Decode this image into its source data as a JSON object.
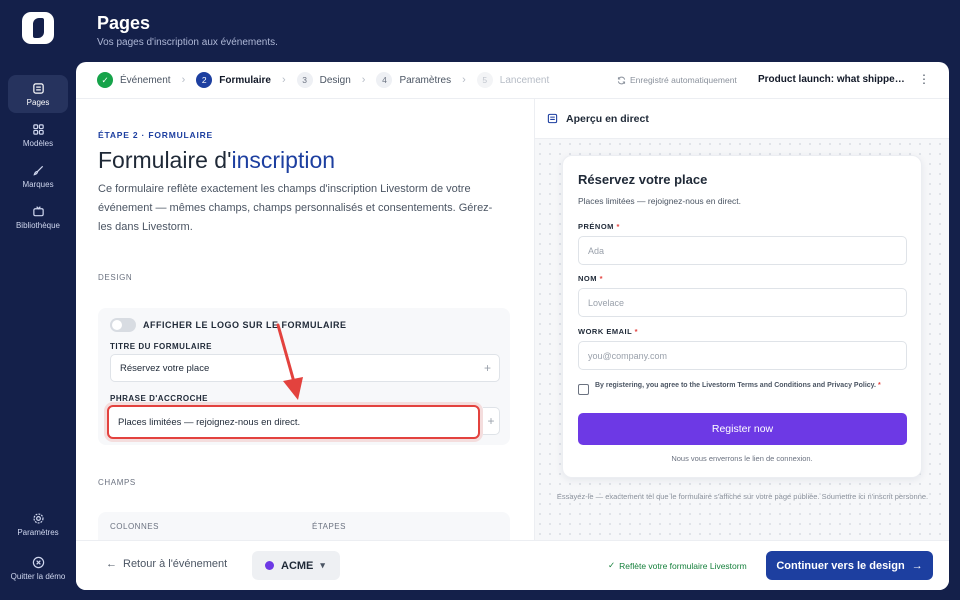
{
  "header": {
    "title": "Pages",
    "subtitle": "Vos pages d'inscription aux événements."
  },
  "sidebar": {
    "items": [
      {
        "label": "Pages",
        "icon": "pages-icon",
        "active": true
      },
      {
        "label": "Modèles",
        "icon": "grid-icon"
      },
      {
        "label": "Marques",
        "icon": "brush-icon"
      },
      {
        "label": "Bibliothèque",
        "icon": "tv-icon"
      }
    ],
    "settings_label": "Paramètres",
    "exit_label": "Quitter la démo"
  },
  "stepper": {
    "steps": [
      {
        "num": "✓",
        "label": "Événement",
        "state": "done"
      },
      {
        "num": "2",
        "label": "Formulaire",
        "state": "current"
      },
      {
        "num": "3",
        "label": "Design",
        "state": "todo"
      },
      {
        "num": "4",
        "label": "Paramètres",
        "state": "todo"
      },
      {
        "num": "5",
        "label": "Lancement",
        "state": "disabled"
      }
    ],
    "autosave": "Enregistré automatiquement",
    "event_name": "Product launch: what shipped this quarter"
  },
  "editor": {
    "eyebrow": "ÉTAPE 2 · FORMULAIRE",
    "title_prefix": "Formulaire d'",
    "title_accent": "inscription",
    "description": "Ce formulaire reflète exactement les champs d'inscription Livestorm de votre événement — mêmes champs, champs personnalisés et consentements. Gérez-les dans Livestorm.",
    "design_label": "DESIGN",
    "show_logo_label": "AFFICHER LE LOGO SUR LE FORMULAIRE",
    "form_title_label": "TITRE DU FORMULAIRE",
    "form_title_value": "Réservez votre place",
    "tagline_label": "PHRASE D'ACCROCHE",
    "tagline_value": "Places limitées — rejoignez-nous en direct.",
    "fields_label": "CHAMPS",
    "columns_label": "COLONNES",
    "steps_label": "ÉTAPES"
  },
  "preview": {
    "header": "Aperçu en direct",
    "title": "Réservez votre place",
    "subtitle": "Places limitées — rejoignez-nous en direct.",
    "fields": [
      {
        "label": "PRÉNOM",
        "placeholder": "Ada"
      },
      {
        "label": "NOM",
        "placeholder": "Lovelace"
      },
      {
        "label": "WORK EMAIL",
        "placeholder": "you@company.com"
      }
    ],
    "required_mark": "*",
    "consent": "By registering, you agree to the Livestorm Terms and Conditions and Privacy Policy.",
    "button": "Register now",
    "note": "Nous vous enverrons le lien de connexion.",
    "footer": "Essayez-le — exactement tel que le formulaire s'affiche sur votre page publiée. Soumettre ici n'inscrit personne."
  },
  "footer": {
    "back": "Retour à l'événement",
    "brand": "ACME",
    "reflect": "Reflète votre formulaire Livestorm",
    "cta": "Continuer vers le design"
  },
  "colors": {
    "navy": "#14204a",
    "primary": "#1d3fa0",
    "purple": "#6d39e5",
    "success": "#16a34a",
    "annotation": "#e3423e"
  }
}
